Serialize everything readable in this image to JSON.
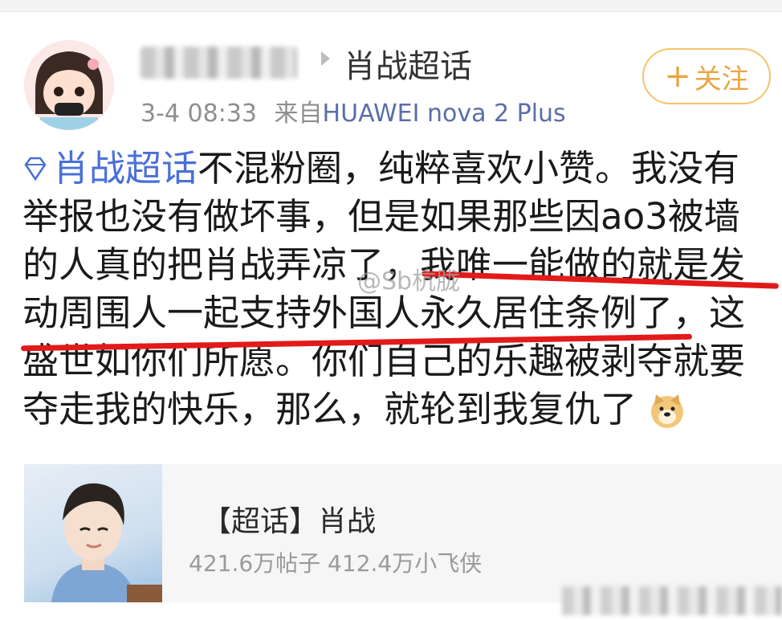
{
  "header": {
    "topic_name": "肖战超话",
    "meta_time": "3-4 08:33",
    "meta_from": "来自",
    "meta_device": "HUAWEI nova 2 Plus",
    "follow_plus": "+",
    "follow_label": "关注",
    "icons": [
      "avatar",
      "arrow-right-icon"
    ]
  },
  "post": {
    "topic_link": "肖战超话",
    "lines": [
      "不混粉圈，纯粹喜欢小赞。我没有",
      "举报也没有做坏事，但是如果那些因ao3被墙",
      "的人真的把肖战弄凉了，我唯一能做的就是发",
      "动周围人一起支持外国人永久居住条例了，这",
      "盛世如你们所愿。你们自己的乐趣被剥夺就要",
      "夺走我的快乐，那么，就轮到我复仇了"
    ],
    "emoji": "doge-icon",
    "topic_icon": "diamond-icon",
    "underline_color": "#e21a1a"
  },
  "watermark": "@Sb杭胧",
  "card": {
    "title": "【超话】肖战",
    "stats": "421.6万帖子 412.4万小飞侠"
  },
  "colors": {
    "link": "#4a6fd8",
    "follow": "#e9a646",
    "meta": "#8e8e8e"
  }
}
